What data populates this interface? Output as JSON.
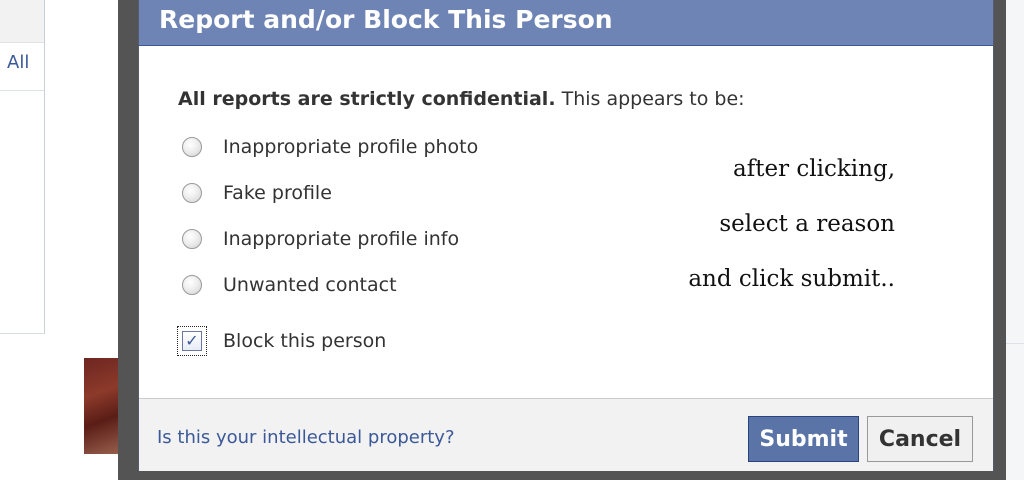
{
  "background": {
    "all_link": "All"
  },
  "dialog": {
    "title": "Report and/or Block This Person",
    "intro_bold": "All reports are strictly confidential.",
    "intro_rest": " This appears to be:",
    "options": [
      {
        "label": "Inappropriate profile photo",
        "selected": false
      },
      {
        "label": "Fake profile",
        "selected": false
      },
      {
        "label": "Inappropriate profile info",
        "selected": false
      },
      {
        "label": "Unwanted contact",
        "selected": false
      }
    ],
    "block_checkbox": {
      "label": "Block this person",
      "checked": true,
      "mark": "✓"
    },
    "annotation_lines": [
      "after clicking,",
      "select a reason",
      "and click submit.."
    ],
    "footer": {
      "ip_link": "Is this your intellectual property?",
      "submit_label": "Submit",
      "cancel_label": "Cancel"
    }
  },
  "colors": {
    "header": "#6d84b4",
    "link": "#3b5998",
    "submit": "#5b74a8"
  }
}
